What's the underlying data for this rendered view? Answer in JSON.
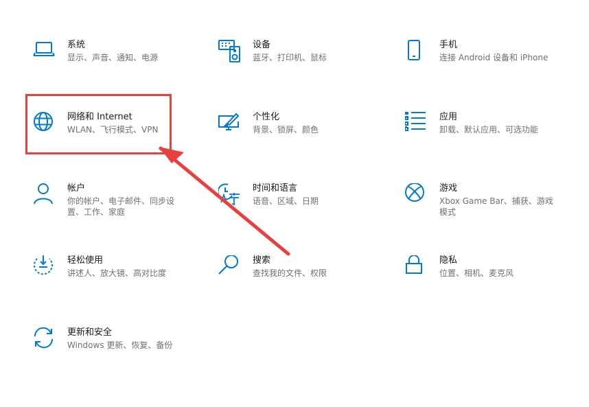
{
  "colors": {
    "accent": "#0078d4",
    "highlight": "#e8403f",
    "title_text": "#1a1a1a",
    "desc_text": "#707070"
  },
  "settings": [
    {
      "id": "system",
      "title": "系统",
      "desc": "显示、声音、通知、电源",
      "icon": "laptop-icon"
    },
    {
      "id": "devices",
      "title": "设备",
      "desc": "蓝牙、打印机、鼠标",
      "icon": "keyboard-speaker-icon"
    },
    {
      "id": "phone",
      "title": "手机",
      "desc": "连接 Android 设备和 iPhone",
      "icon": "phone-icon"
    },
    {
      "id": "network",
      "title": "网络和 Internet",
      "desc": "WLAN、飞行模式、VPN",
      "icon": "globe-icon"
    },
    {
      "id": "personalization",
      "title": "个性化",
      "desc": "背景、锁屏、颜色",
      "icon": "monitor-brush-icon"
    },
    {
      "id": "apps",
      "title": "应用",
      "desc": "卸载、默认应用、可选功能",
      "icon": "app-list-icon"
    },
    {
      "id": "accounts",
      "title": "帐户",
      "desc": "你的帐户、电子邮件、同步设置、工作、家庭",
      "icon": "person-icon"
    },
    {
      "id": "time-language",
      "title": "时间和语言",
      "desc": "语音、区域、日期",
      "icon": "time-language-icon"
    },
    {
      "id": "gaming",
      "title": "游戏",
      "desc": "Xbox Game Bar、捕获、游戏模式",
      "icon": "xbox-icon"
    },
    {
      "id": "ease-of-access",
      "title": "轻松使用",
      "desc": "讲述人、放大镜、高对比度",
      "icon": "ease-of-access-icon"
    },
    {
      "id": "search",
      "title": "搜索",
      "desc": "查找我的文件、权限",
      "icon": "search-icon"
    },
    {
      "id": "privacy",
      "title": "隐私",
      "desc": "位置、相机、麦克风",
      "icon": "lock-icon"
    },
    {
      "id": "update-security",
      "title": "更新和安全",
      "desc": "Windows 更新、恢复、备份",
      "icon": "sync-icon"
    }
  ]
}
